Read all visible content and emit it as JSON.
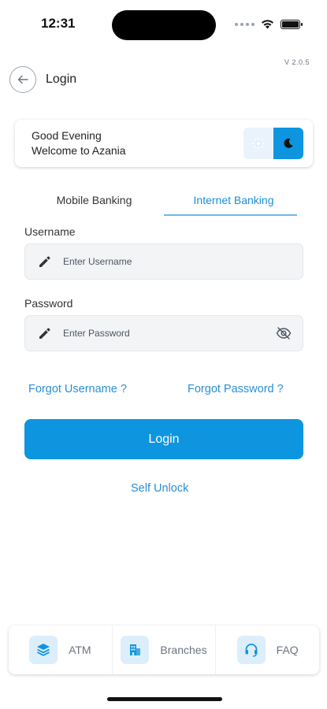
{
  "status": {
    "time": "12:31"
  },
  "version": "V 2.0.5",
  "header": {
    "title": "Login"
  },
  "greeting": {
    "line1": "Good Evening",
    "line2": "Welcome to Azania"
  },
  "tabs": [
    {
      "label": "Mobile Banking",
      "active": false
    },
    {
      "label": "Internet Banking",
      "active": true
    }
  ],
  "form": {
    "username": {
      "label": "Username",
      "placeholder": "Enter Username",
      "value": ""
    },
    "password": {
      "label": "Password",
      "placeholder": "Enter Password",
      "value": ""
    }
  },
  "links": {
    "forgot_username": "Forgot Username ?",
    "forgot_password": "Forgot Password ?",
    "self_unlock": "Self Unlock"
  },
  "login_button": "Login",
  "bottom_nav": [
    {
      "label": "ATM",
      "icon": "layers-icon"
    },
    {
      "label": "Branches",
      "icon": "building-icon"
    },
    {
      "label": "FAQ",
      "icon": "headset-icon"
    }
  ],
  "colors": {
    "accent": "#0e95df",
    "link": "#2b8ed5",
    "icon_bg": "#ddeefb"
  }
}
